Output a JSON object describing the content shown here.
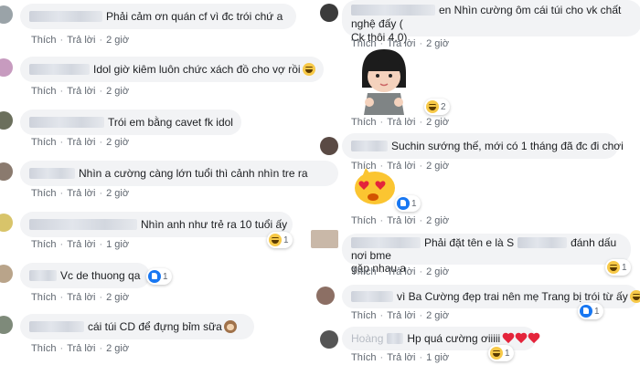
{
  "actions": {
    "like": "Thích",
    "reply": "Trả lời",
    "dot": "·"
  },
  "colors": {
    "bubble": "#f2f3f5",
    "meta": "#606770",
    "like_blue": "#1877f2",
    "heart_red": "#e4243b",
    "laugh_yellow": "#f7c948"
  },
  "left_comments": [
    {
      "text": "Phải cảm ơn quán cf vì đc trói chứ a",
      "time": "2 giờ"
    },
    {
      "text": "Idol giờ kiêm luôn chức xách đồ cho vợ rồi",
      "emoji": "laugh-emoji",
      "time": "2 giờ"
    },
    {
      "text": "Trói em bằng cavet fk idol",
      "time": "2 giờ"
    },
    {
      "text": "Nhìn a cường càng lớn tuổi thì cảnh nhìn tre ra",
      "time": "2 giờ"
    },
    {
      "text": "Nhìn anh như trẻ ra 10 tuổi ấy",
      "time": "1 giờ",
      "reaction": {
        "type": "laugh",
        "count": "1"
      }
    },
    {
      "text": "Vc de thuong qa",
      "time": "2 giờ",
      "reaction": {
        "type": "like",
        "count": "1"
      }
    },
    {
      "text": "cái túi CD để đựng bỉm sữa",
      "emoji": "monkey-emoji",
      "time": "2 giờ"
    }
  ],
  "right_comments": [
    {
      "line1": "en Nhìn cường ôm cái túi cho vk chất nghệ đấy (",
      "line2": "Ck thôi 4,0)",
      "time": "2 giờ"
    },
    {
      "sticker": "girl-sticker",
      "time": "2 giờ",
      "reaction": {
        "type": "laugh",
        "count": "2"
      }
    },
    {
      "text": "Suchin sướng thế, mới có 1 tháng đã đc đi chơi",
      "time": "2 giờ"
    },
    {
      "sticker": "heart-eyes-sticker",
      "time": "2 giờ",
      "reaction": {
        "type": "like",
        "count": "1"
      }
    },
    {
      "line1": "Phải đặt tên e là S",
      "line1b": "đánh dấu nơi bme",
      "line2": "gặp nhau a",
      "time": "2 giờ",
      "reaction": {
        "type": "laugh",
        "count": "1"
      }
    },
    {
      "text": "vì Ba Cường đẹp trai nên mẹ Trang bị trói từ ấy",
      "emoji": "laugh-emoji",
      "time": "2 giờ",
      "reaction": {
        "type": "like",
        "count": "1"
      }
    },
    {
      "prefix": "Hoàng",
      "text": "Hp quá cường ơiiiii",
      "emoji": "hearts-emoji",
      "time": "1 giờ",
      "reaction": {
        "type": "laugh",
        "count": "1"
      }
    }
  ]
}
